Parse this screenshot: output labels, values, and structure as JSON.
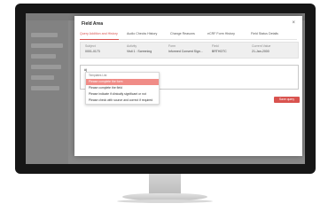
{
  "modal": {
    "title": "Field Area",
    "close_symbol": "×"
  },
  "tabs": [
    {
      "label": "Query Addition and History"
    },
    {
      "label": "Audio Checks History"
    },
    {
      "label": "Change Reasons"
    },
    {
      "label": "eCRF Form History"
    },
    {
      "label": "Field Status Details"
    }
  ],
  "info": [
    {
      "label": "Subject",
      "value": "0001-0173"
    },
    {
      "label": "Activity",
      "value": "Visit 1 : Screening"
    },
    {
      "label": "Form",
      "value": "Informed Consent Sign..."
    },
    {
      "label": "Field",
      "value": "BRTHDTC"
    },
    {
      "label": "Current Value",
      "value": "21-Jan-2000"
    }
  ],
  "query": {
    "value": "#|"
  },
  "suggestions": {
    "header": "Templates List",
    "items": [
      "Please complete the form",
      "Please complete the field",
      "Please indicate if clinically significant or not",
      "Please check with source and correct if required"
    ],
    "highlighted_index": 0
  },
  "save_label": "Save query",
  "colors": {
    "accent": "#d9534f",
    "highlight": "#f08c87"
  }
}
